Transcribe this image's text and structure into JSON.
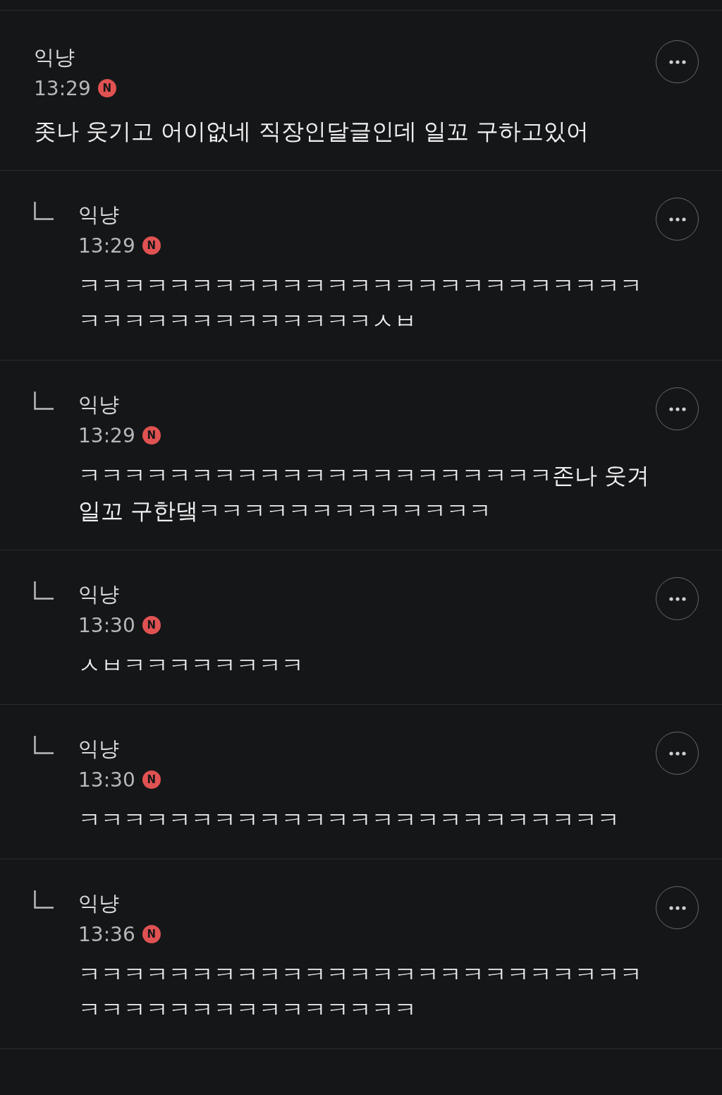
{
  "comments": [
    {
      "kind": "post",
      "author": "익냥",
      "time": "13:29",
      "badge": "N",
      "text": "좃나 웃기고 어이없네 직장인달글인데 일꼬 구하고있어"
    },
    {
      "kind": "reply",
      "author": "익냥",
      "time": "13:29",
      "badge": "N",
      "text": "ㅋㅋㅋㅋㅋㅋㅋㅋㅋㅋㅋㅋㅋㅋㅋㅋㅋㅋㅋㅋㅋㅋㅋㅋㅋㅋㅋㅋㅋㅋㅋㅋㅋㅋㅋㅋㅋㅋㅅㅂ"
    },
    {
      "kind": "reply",
      "author": "익냥",
      "time": "13:29",
      "badge": "N",
      "text": "ㅋㅋㅋㅋㅋㅋㅋㅋㅋㅋㅋㅋㅋㅋㅋㅋㅋㅋㅋㅋㅋ존나 웃겨 일꼬 구한댘ㅋㅋㅋㅋㅋㅋㅋㅋㅋㅋㅋㅋㅋ"
    },
    {
      "kind": "reply",
      "author": "익냥",
      "time": "13:30",
      "badge": "N",
      "text": "ㅅㅂㅋㅋㅋㅋㅋㅋㅋㅋ"
    },
    {
      "kind": "reply",
      "author": "익냥",
      "time": "13:30",
      "badge": "N",
      "text": "ㅋㅋㅋㅋㅋㅋㅋㅋㅋㅋㅋㅋㅋㅋㅋㅋㅋㅋㅋㅋㅋㅋㅋㅋ"
    },
    {
      "kind": "reply",
      "author": "익냥",
      "time": "13:36",
      "badge": "N",
      "text": "ㅋㅋㅋㅋㅋㅋㅋㅋㅋㅋㅋㅋㅋㅋㅋㅋㅋㅋㅋㅋㅋㅋㅋㅋㅋㅋㅋㅋㅋㅋㅋㅋㅋㅋㅋㅋㅋㅋㅋㅋ"
    }
  ]
}
